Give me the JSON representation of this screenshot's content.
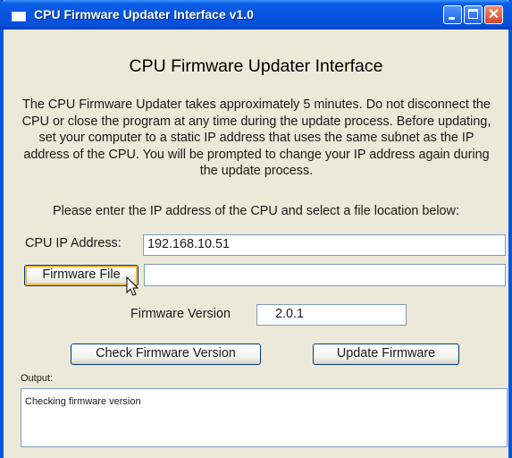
{
  "window": {
    "title": "CPU Firmware Updater Interface v1.0",
    "controls": {
      "minimize_icon": "minimize-icon",
      "maximize_icon": "maximize-icon",
      "close_icon": "close-icon",
      "close_glyph": "✕"
    }
  },
  "main": {
    "heading": "CPU Firmware Updater Interface",
    "description": "The CPU Firmware Updater takes approximately 5 minutes. Do not disconnect the CPU or close the program at any time during the update process. Before updating, set your computer to a static IP address that uses the same subnet as the IP address of the CPU. You will be prompted to change your IP address again during the update process.",
    "prompt": "Please enter the IP address of the CPU and select a file location below:"
  },
  "form": {
    "ip_label": "CPU IP Address:",
    "ip_value": "192.168.10.51",
    "file_button_label": "Firmware File",
    "file_path_value": "",
    "version_label": "Firmware Version",
    "version_value": "2.0.1"
  },
  "actions": {
    "check_label": "Check Firmware Version",
    "update_label": "Update Firmware"
  },
  "output": {
    "label": "Output:",
    "text": "Checking firmware version"
  },
  "colors": {
    "title_bar": "#0654e2",
    "window_bg": "#ece9d8",
    "button_focus": "#f7b64a",
    "input_border": "#7f9db9"
  }
}
